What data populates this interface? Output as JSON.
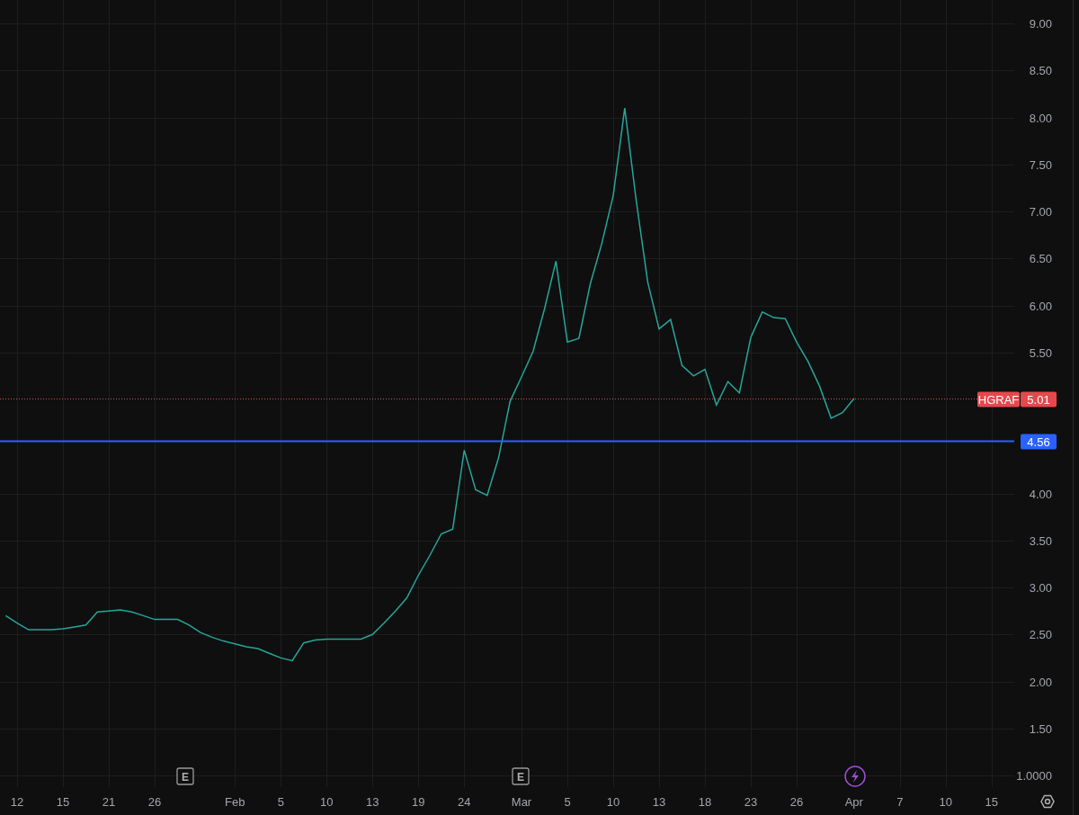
{
  "chart": {
    "chart_data": {
      "type": "line",
      "grid": true,
      "ylim": [
        0.876,
        9.249
      ],
      "categories": [
        null,
        "12",
        null,
        null,
        null,
        "15",
        null,
        null,
        null,
        "21",
        null,
        null,
        null,
        "26",
        null,
        null,
        null,
        null,
        null,
        null,
        "Feb",
        null,
        null,
        null,
        "5",
        null,
        null,
        null,
        "10",
        null,
        null,
        null,
        "13",
        null,
        null,
        null,
        "19",
        null,
        null,
        null,
        "24",
        null,
        null,
        null,
        null,
        "Mar",
        null,
        null,
        null,
        "5",
        null,
        null,
        null,
        "10",
        null,
        null,
        null,
        "13",
        null,
        null,
        null,
        "18",
        null,
        null,
        null,
        "23",
        null,
        null,
        null,
        "26",
        null,
        null,
        null,
        null,
        "Apr",
        null,
        null,
        null,
        "7",
        null,
        null,
        null,
        "10",
        null,
        null,
        null,
        "15",
        null
      ],
      "yticks": [
        {
          "value": 9,
          "label": "9.00"
        },
        {
          "value": 8.5,
          "label": "8.50"
        },
        {
          "value": 8,
          "label": "8.00"
        },
        {
          "value": 7.5,
          "label": "7.50"
        },
        {
          "value": 7,
          "label": "7.00"
        },
        {
          "value": 6.5,
          "label": "6.50"
        },
        {
          "value": 6,
          "label": "6.00"
        },
        {
          "value": 5.5,
          "label": "5.50"
        },
        {
          "value": 4,
          "label": "4.00"
        },
        {
          "value": 3.5,
          "label": "3.50"
        },
        {
          "value": 3,
          "label": "3.00"
        },
        {
          "value": 2.5,
          "label": "2.50"
        },
        {
          "value": 2,
          "label": "2.00"
        },
        {
          "value": 1.5,
          "label": "1.50"
        },
        {
          "value": 1,
          "label": "1.0000"
        }
      ],
      "series": [
        {
          "color": "#26a69a",
          "values": [
            2.7,
            2.62,
            2.55,
            2.55,
            2.55,
            2.56,
            2.58,
            2.6,
            2.74,
            2.75,
            2.76,
            2.74,
            2.7,
            2.66,
            2.66,
            2.66,
            2.6,
            2.52,
            2.47,
            2.43,
            2.4,
            2.37,
            2.35,
            2.3,
            2.25,
            2.22,
            2.41,
            2.44,
            2.45,
            2.45,
            2.45,
            2.45,
            2.5,
            2.62,
            2.75,
            2.89,
            3.13,
            3.34,
            3.57,
            3.62,
            4.46,
            4.04,
            3.98,
            4.38,
            4.98,
            5.24,
            5.51,
            5.96,
            6.47,
            5.61,
            5.65,
            6.23,
            6.66,
            7.17,
            8.1,
            7.12,
            6.25,
            5.75,
            5.85,
            5.36,
            5.25,
            5.32,
            4.94,
            5.19,
            5.07,
            5.66,
            5.93,
            5.87,
            5.86,
            5.61,
            5.4,
            5.14,
            4.8,
            4.86,
            5.01,
            null,
            null,
            null,
            null,
            null,
            null,
            null,
            null,
            null,
            null,
            null,
            null,
            null
          ]
        }
      ],
      "ref_lines": [
        {
          "axis": "y",
          "value": 5.01,
          "label": "5.01",
          "color": "#e5484d"
        },
        {
          "axis": "y",
          "value": 4.56,
          "label": "4.56",
          "color": "#2962ff"
        }
      ]
    },
    "price_lines": [
      {
        "kind": "last_price",
        "symbol": "HGRAF"
      },
      {
        "kind": "drawn_line"
      }
    ],
    "events": [
      {
        "kind": "earnings",
        "label": "E"
      },
      {
        "kind": "earnings",
        "label": "E"
      },
      {
        "kind": "news"
      }
    ]
  }
}
